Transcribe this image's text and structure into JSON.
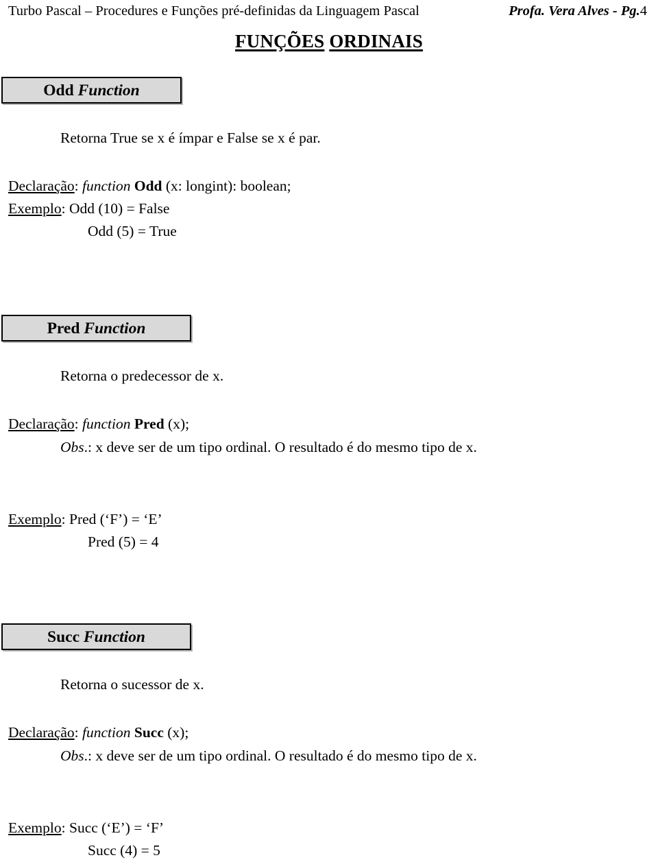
{
  "header": {
    "left": "Turbo Pascal – Procedures e Funções pré-definidas da Linguagem Pascal",
    "right_bold": "Profa. Vera Alves  -  Pg.",
    "right_page": "4"
  },
  "title": {
    "word1": "FUNÇÕES",
    "word2": "ORDINAIS"
  },
  "sections": [
    {
      "box": {
        "name": "Odd",
        "word": "Function"
      },
      "description": "Retorna True se x é ímpar e False se x é par.",
      "declaration": {
        "label": "Declaração",
        "colon": ": ",
        "keyword": "function",
        "name": "Odd",
        "signature": "(x: longint): boolean;"
      },
      "example": {
        "label": "Exemplo",
        "colon": ": ",
        "line1": "Odd (10) = False",
        "line2": "Odd (5) = True"
      }
    },
    {
      "box": {
        "name": "Pred",
        "word": "Function"
      },
      "description": "Retorna o predecessor de x.",
      "declaration": {
        "label": "Declaração",
        "colon": ": ",
        "keyword": "function",
        "name": "Pred",
        "signature": "(x);"
      },
      "note": {
        "label": "Obs",
        "text": ".: x deve ser de um tipo ordinal. O resultado é do mesmo tipo de x."
      },
      "example": {
        "label": "Exemplo",
        "colon": ": ",
        "line1": "Pred (‘F’) = ‘E’",
        "line2": "Pred (5) = 4"
      }
    },
    {
      "box": {
        "name": "Succ",
        "word": "Function"
      },
      "description": "Retorna o sucessor de x.",
      "declaration": {
        "label": "Declaração",
        "colon": ": ",
        "keyword": "function",
        "name": "Succ",
        "signature": "(x);"
      },
      "note": {
        "label": "Obs",
        "text": ".: x deve ser de um tipo ordinal. O resultado é do mesmo tipo de x."
      },
      "example": {
        "label": "Exemplo",
        "colon": ": ",
        "line1": "Succ (‘E’) = ‘F’",
        "line2": "Succ (4) = 5"
      }
    }
  ],
  "colors": {
    "page_background": "#ffffff",
    "text": "#000000",
    "box_fill": "#d9d9d9",
    "box_border": "#000000",
    "box_shadow": "#b5b5b5"
  }
}
